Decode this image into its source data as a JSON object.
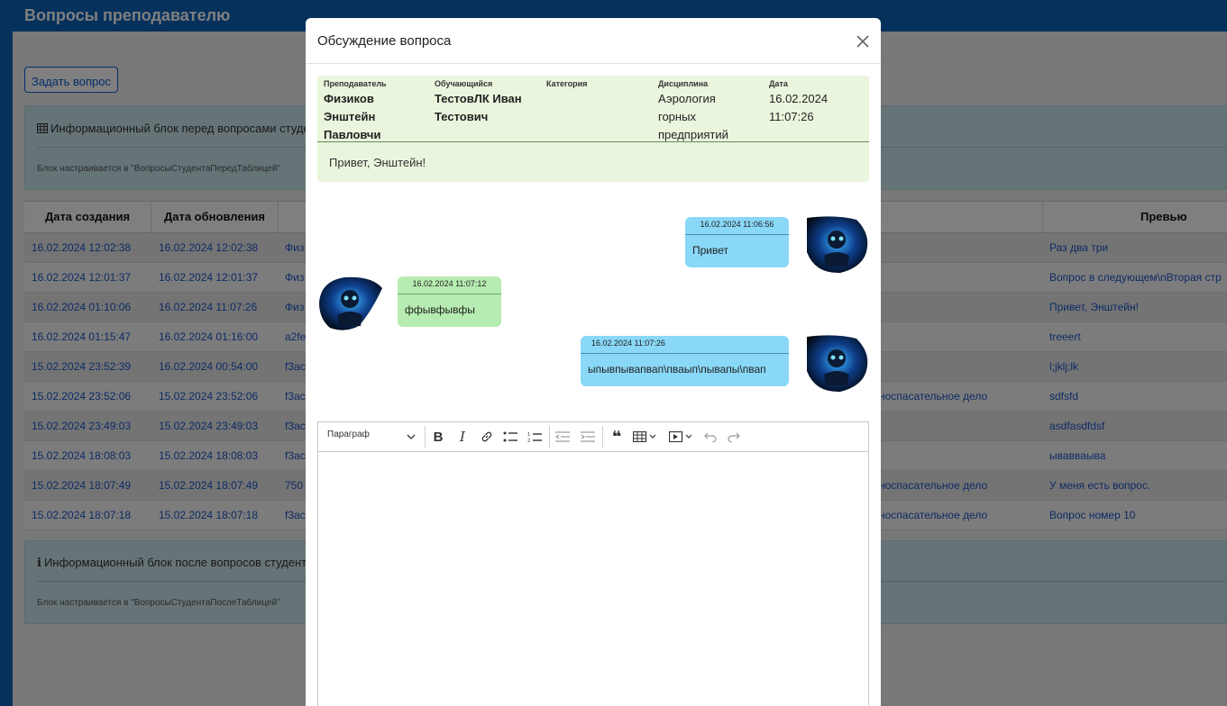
{
  "page": {
    "title": "Вопросы преподавателю",
    "ask_button": "Задать вопрос",
    "info_before": {
      "title": "Информационный блок перед вопросами студе",
      "note": "Блок настраивается в \"ВопросыСтудентаПередТаблицей\""
    },
    "info_after": {
      "title": "Информационный блок после вопросов студента",
      "note": "Блок настраивается в \"ВопросыСтудентаПослеТаблицей\""
    },
    "table": {
      "headers": [
        "Дата создания",
        "Дата обновления",
        "",
        "",
        "Превью вопрос"
      ],
      "rows": [
        {
          "created": "16.02.2024 12:02:38",
          "updated": "16.02.2024 12:02:38",
          "c3": "Физ",
          "c4": "",
          "preview": "Раз два три"
        },
        {
          "created": "16.02.2024 12:01:37",
          "updated": "16.02.2024 12:01:37",
          "c3": "Физ",
          "c4": "",
          "preview": "Вопрос в следующем\\nВторая стр"
        },
        {
          "created": "16.02.2024 01:10:06",
          "updated": "16.02.2024 11:07:26",
          "c3": "Физ",
          "c4": "",
          "preview": "Привет, Энштейн!"
        },
        {
          "created": "16.02.2024 01:15:47",
          "updated": "16.02.2024 01:16:00",
          "c3": "a2fe",
          "c4": "",
          "preview": "treeert"
        },
        {
          "created": "15.02.2024 23:52:39",
          "updated": "16.02.2024 00:54:00",
          "c3": "f3ac",
          "c4": "",
          "preview": "l;jklj;lk"
        },
        {
          "created": "15.02.2024 23:52:06",
          "updated": "15.02.2024 23:52:06",
          "c3": "f3ac",
          "c4": "носпасательное дело",
          "preview": "sdfsfd"
        },
        {
          "created": "15.02.2024 23:49:03",
          "updated": "15.02.2024 23:49:03",
          "c3": "f3ac",
          "c4": "",
          "preview": "asdfasdfdsf"
        },
        {
          "created": "15.02.2024 18:08:03",
          "updated": "15.02.2024 18:08:03",
          "c3": "f3ac",
          "c4": "",
          "preview": "ывавваыва"
        },
        {
          "created": "15.02.2024 18:07:49",
          "updated": "15.02.2024 18:07:49",
          "c3": "750",
          "c4": "носпасательное дело",
          "preview": "У меня есть вопрос."
        },
        {
          "created": "15.02.2024 18:07:18",
          "updated": "15.02.2024 18:07:18",
          "c3": "f3ac",
          "c4": "носпасательное дело",
          "preview": "Вопрос номер 10"
        }
      ]
    }
  },
  "modal": {
    "title": "Обсуждение вопроса",
    "question": {
      "teacher_label": "Преподаватель",
      "teacher_value": [
        "Физиков",
        "Энштейн",
        "Павловчи"
      ],
      "student_label": "Обучающийся",
      "student_value": [
        "ТестовЛК Иван",
        "Тестович"
      ],
      "category_label": "Категория",
      "discipline_label": "Дисциплина",
      "discipline_value": [
        "Аэрология",
        "горных",
        "предприятий"
      ],
      "date_label": "Дата",
      "date_value": [
        "16.02.2024",
        "11:07:26"
      ],
      "text": "Привет, Энштейн!"
    },
    "messages": [
      {
        "side": "right",
        "date": "16.02.2024 11:06:56",
        "text": "Привет"
      },
      {
        "side": "left",
        "date": "16.02.2024 11:07:12",
        "text": "ффывфывфы"
      },
      {
        "side": "right",
        "date": "16.02.2024 11:07:26",
        "text": "ыпывпывапвап\\пваып\\пывапы\\пвап"
      }
    ],
    "editor": {
      "paragraph_label": "Параграф"
    }
  },
  "colors": {
    "brand": "#0b63b8",
    "link": "#1a57c9",
    "question_bg": "#eaf5dd",
    "msg_mine": "#8ad8f8",
    "msg_other": "#b6ecb1"
  }
}
